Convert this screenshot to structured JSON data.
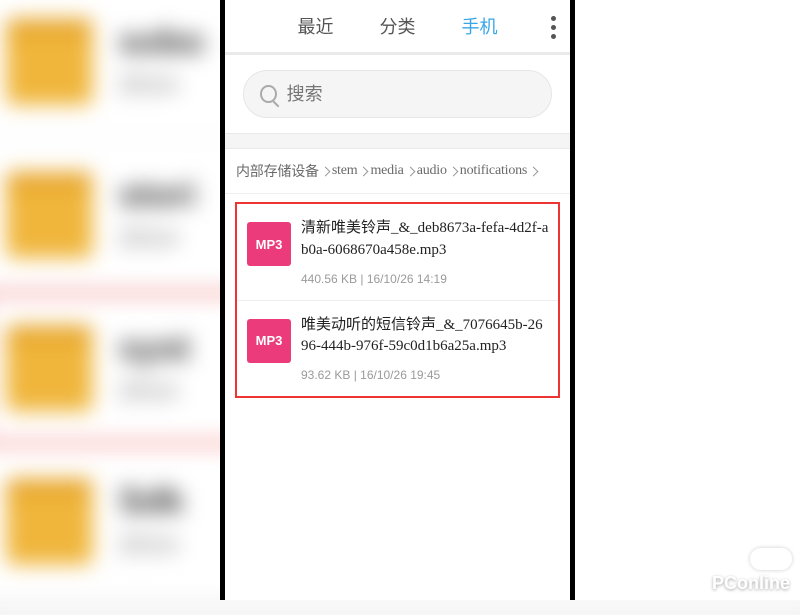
{
  "bg_rows": [
    {
      "t": "sobo",
      "s": "2014-",
      "hl": false
    },
    {
      "t": "stori",
      "s": "2014-",
      "hl": false
    },
    {
      "t": "syst",
      "s": "2014-",
      "hl": true
    },
    {
      "t": "Sdk",
      "s": "2014-",
      "hl": false
    }
  ],
  "tabs": {
    "recent": "最近",
    "category": "分类",
    "phone": "手机"
  },
  "search": {
    "placeholder": "搜索"
  },
  "breadcrumb": [
    "内部存储设备",
    "stem",
    "media",
    "audio",
    "notifications"
  ],
  "files": [
    {
      "badge": "MP3",
      "name": "清新唯美铃声_&_deb8673a-fefa-4d2f-ab0a-6068670a458e.mp3",
      "meta": "440.56 KB | 16/10/26 14:19"
    },
    {
      "badge": "MP3",
      "name": "唯美动听的短信铃声_&_7076645b-2696-444b-976f-59c0d1b6a25a.mp3",
      "meta": "93.62 KB | 16/10/26 19:45"
    }
  ],
  "watermark": "PConline"
}
